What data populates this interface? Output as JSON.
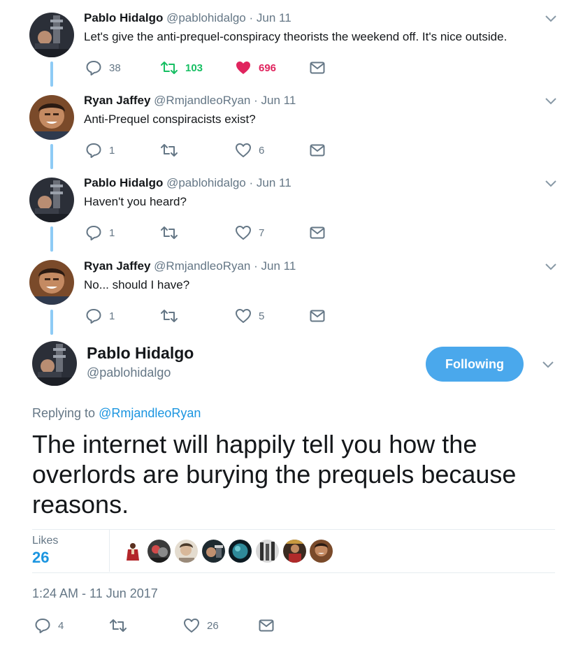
{
  "thread": [
    {
      "name": "Pablo Hidalgo",
      "handle": "@pablohidalgo",
      "separator": "·",
      "date": "Jun 11",
      "text": "Let's give the anti-prequel-conspiracy theorists the weekend off. It's nice outside.",
      "replies": "38",
      "retweets": "103",
      "likes": "696",
      "retweeted": true,
      "liked": true
    },
    {
      "name": "Ryan Jaffey",
      "handle": "@RmjandleoRyan",
      "separator": "·",
      "date": "Jun 11",
      "text": "Anti-Prequel conspiracists exist?",
      "replies": "1",
      "retweets": "",
      "likes": "6"
    },
    {
      "name": "Pablo Hidalgo",
      "handle": "@pablohidalgo",
      "separator": "·",
      "date": "Jun 11",
      "text": "Haven't you heard?",
      "replies": "1",
      "retweets": "",
      "likes": "7"
    },
    {
      "name": "Ryan Jaffey",
      "handle": "@RmjandleoRyan",
      "separator": "·",
      "date": "Jun 11",
      "text": "No... should I have?",
      "replies": "1",
      "retweets": "",
      "likes": "5"
    }
  ],
  "main": {
    "name": "Pablo Hidalgo",
    "handle": "@pablohidalgo",
    "follow_label": "Following",
    "replying_prefix": "Replying to",
    "replying_to": "@RmjandleoRyan",
    "text": "The internet will happily tell you how the overlords are burying the prequels because reasons.",
    "likes_label": "Likes",
    "likes_count": "26",
    "timestamp": "1:24 AM - 11 Jun 2017",
    "replies": "4",
    "retweets": "",
    "likes": "26"
  },
  "colors": {
    "accent": "#1b95e0",
    "follow_button": "#4aa8ec",
    "retweet_active": "#17bf63",
    "like_active": "#e0245e",
    "muted": "#657786",
    "thread_line": "#8ecbf5"
  },
  "icons": [
    "reply-icon",
    "retweet-icon",
    "heart-icon",
    "mail-icon",
    "chevron-down-icon"
  ]
}
